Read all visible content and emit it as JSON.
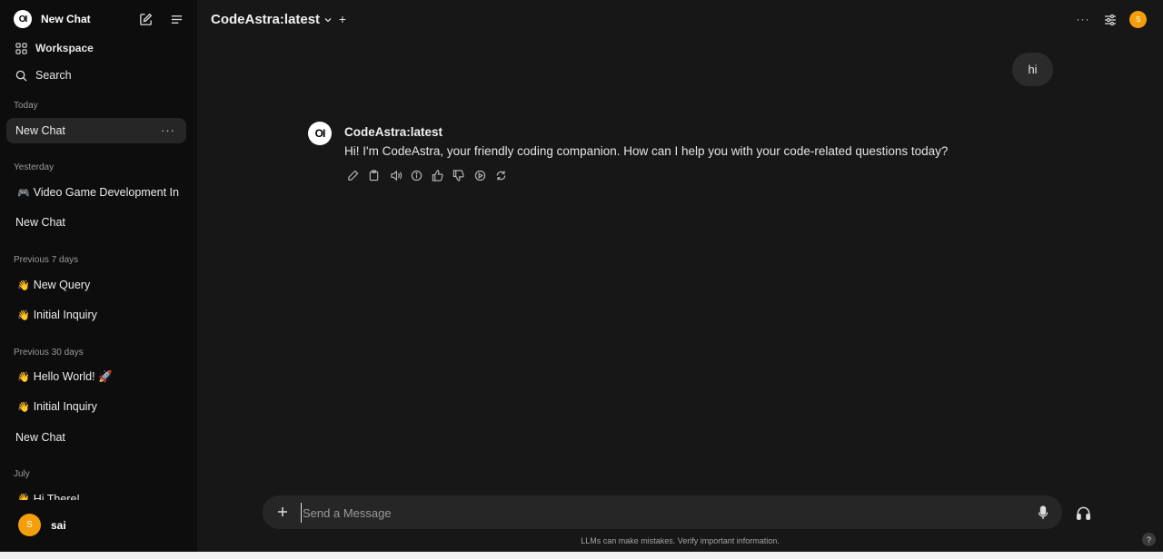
{
  "sidebar": {
    "logo": "OI",
    "title": "New Chat",
    "workspace_label": "Workspace",
    "search_label": "Search",
    "sections": {
      "today": "Today",
      "yesterday": "Yesterday",
      "prev7": "Previous 7 days",
      "prev30": "Previous 30 days",
      "july": "July"
    },
    "items": [
      {
        "label": "New Chat",
        "emoji": ""
      },
      {
        "label": "Video Game Development Insights",
        "emoji": "🎮"
      },
      {
        "label": "New Chat",
        "emoji": ""
      },
      {
        "label": "New Query",
        "emoji": "👋"
      },
      {
        "label": "Initial Inquiry",
        "emoji": "👋"
      },
      {
        "label": "Hello World! 🚀",
        "emoji": "👋"
      },
      {
        "label": "Initial Inquiry",
        "emoji": "👋"
      },
      {
        "label": "New Chat",
        "emoji": ""
      },
      {
        "label": "Hi There!",
        "emoji": "👋"
      }
    ],
    "more_label": "···",
    "user": {
      "initial": "S",
      "name": "sai"
    }
  },
  "header": {
    "model": "CodeAstra:latest",
    "plus": "+",
    "more": "···",
    "avatar_initial": "S"
  },
  "chat": {
    "user_message": "hi",
    "bot_logo": "OI",
    "bot_name": "CodeAstra:latest",
    "bot_message": "Hi! I'm CodeAstra, your friendly coding companion. How can I help you with your code-related questions today?"
  },
  "input": {
    "placeholder": "Send a Message",
    "plus": "+"
  },
  "footer": {
    "disclaimer": "LLMs can make mistakes. Verify important information.",
    "help": "?"
  },
  "colors": {
    "background": "#171717",
    "sidebar": "#0d0d0d",
    "input": "#262626",
    "accent": "#f59e0b"
  }
}
